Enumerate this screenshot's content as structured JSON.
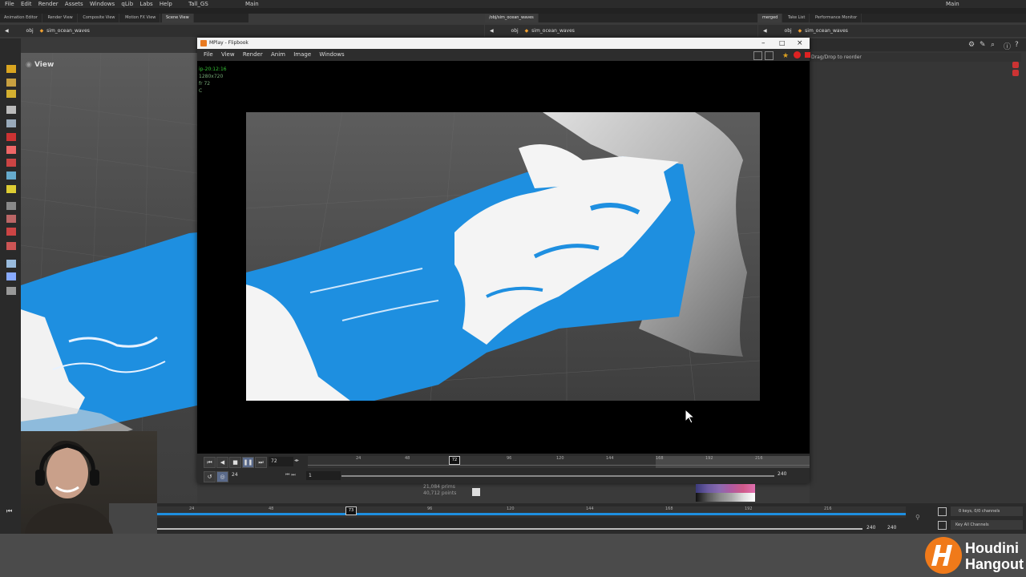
{
  "menubar": {
    "items": [
      "File",
      "Edit",
      "Render",
      "Assets",
      "Windows",
      "qLib",
      "Labs",
      "Help"
    ],
    "desktop": "Tall_GS",
    "main": "Main",
    "right_desktop": "Main"
  },
  "tabs_left": [
    "Animation Editor",
    "Render View",
    "Composite View",
    "Motion FX View",
    "Scene View"
  ],
  "tabs_mid": [
    "/obj/sim_ocean_waves"
  ],
  "tabs_right": [
    "merged",
    "Take List",
    "Performance Monitor"
  ],
  "path_left": {
    "root": "obj",
    "node": "sim_ocean_waves"
  },
  "path_mid": {
    "root": "obj",
    "node": "sim_ocean_waves"
  },
  "path_right": {
    "root": "obj",
    "node": "sim_ocean_waves"
  },
  "viewport": {
    "label": "View"
  },
  "right_hint": "Drag/Drop to reorder",
  "mplay": {
    "title": "MPlay - Flipbook",
    "menu": [
      "File",
      "View",
      "Render",
      "Anim",
      "Image",
      "Windows"
    ],
    "overlay": {
      "line1": "ip-20:12:16",
      "line2": "1280x720",
      "line3": "fr 72",
      "line4": "C"
    },
    "frame": "72",
    "marker": "72",
    "step": "24",
    "start": "1",
    "end": "240",
    "ticks": [
      "24",
      "48",
      "72",
      "96",
      "120",
      "144",
      "168",
      "192",
      "216"
    ]
  },
  "status": {
    "line1": "21,084 prims",
    "line2": "40,712 points"
  },
  "timeline": {
    "marker": "73",
    "ticks": [
      "24",
      "48",
      "72",
      "96",
      "120",
      "144",
      "168",
      "192",
      "216"
    ],
    "end_a": "240",
    "end_b": "240",
    "keys": "0 keys, 0/0 channels",
    "key_all": "Key All Channels"
  },
  "brand": {
    "line1": "Houdini",
    "line2": "Hangout"
  },
  "colors": {
    "accent": "#1e8fe0",
    "brand_orange": "#f07a1a",
    "green": "#36c436"
  }
}
